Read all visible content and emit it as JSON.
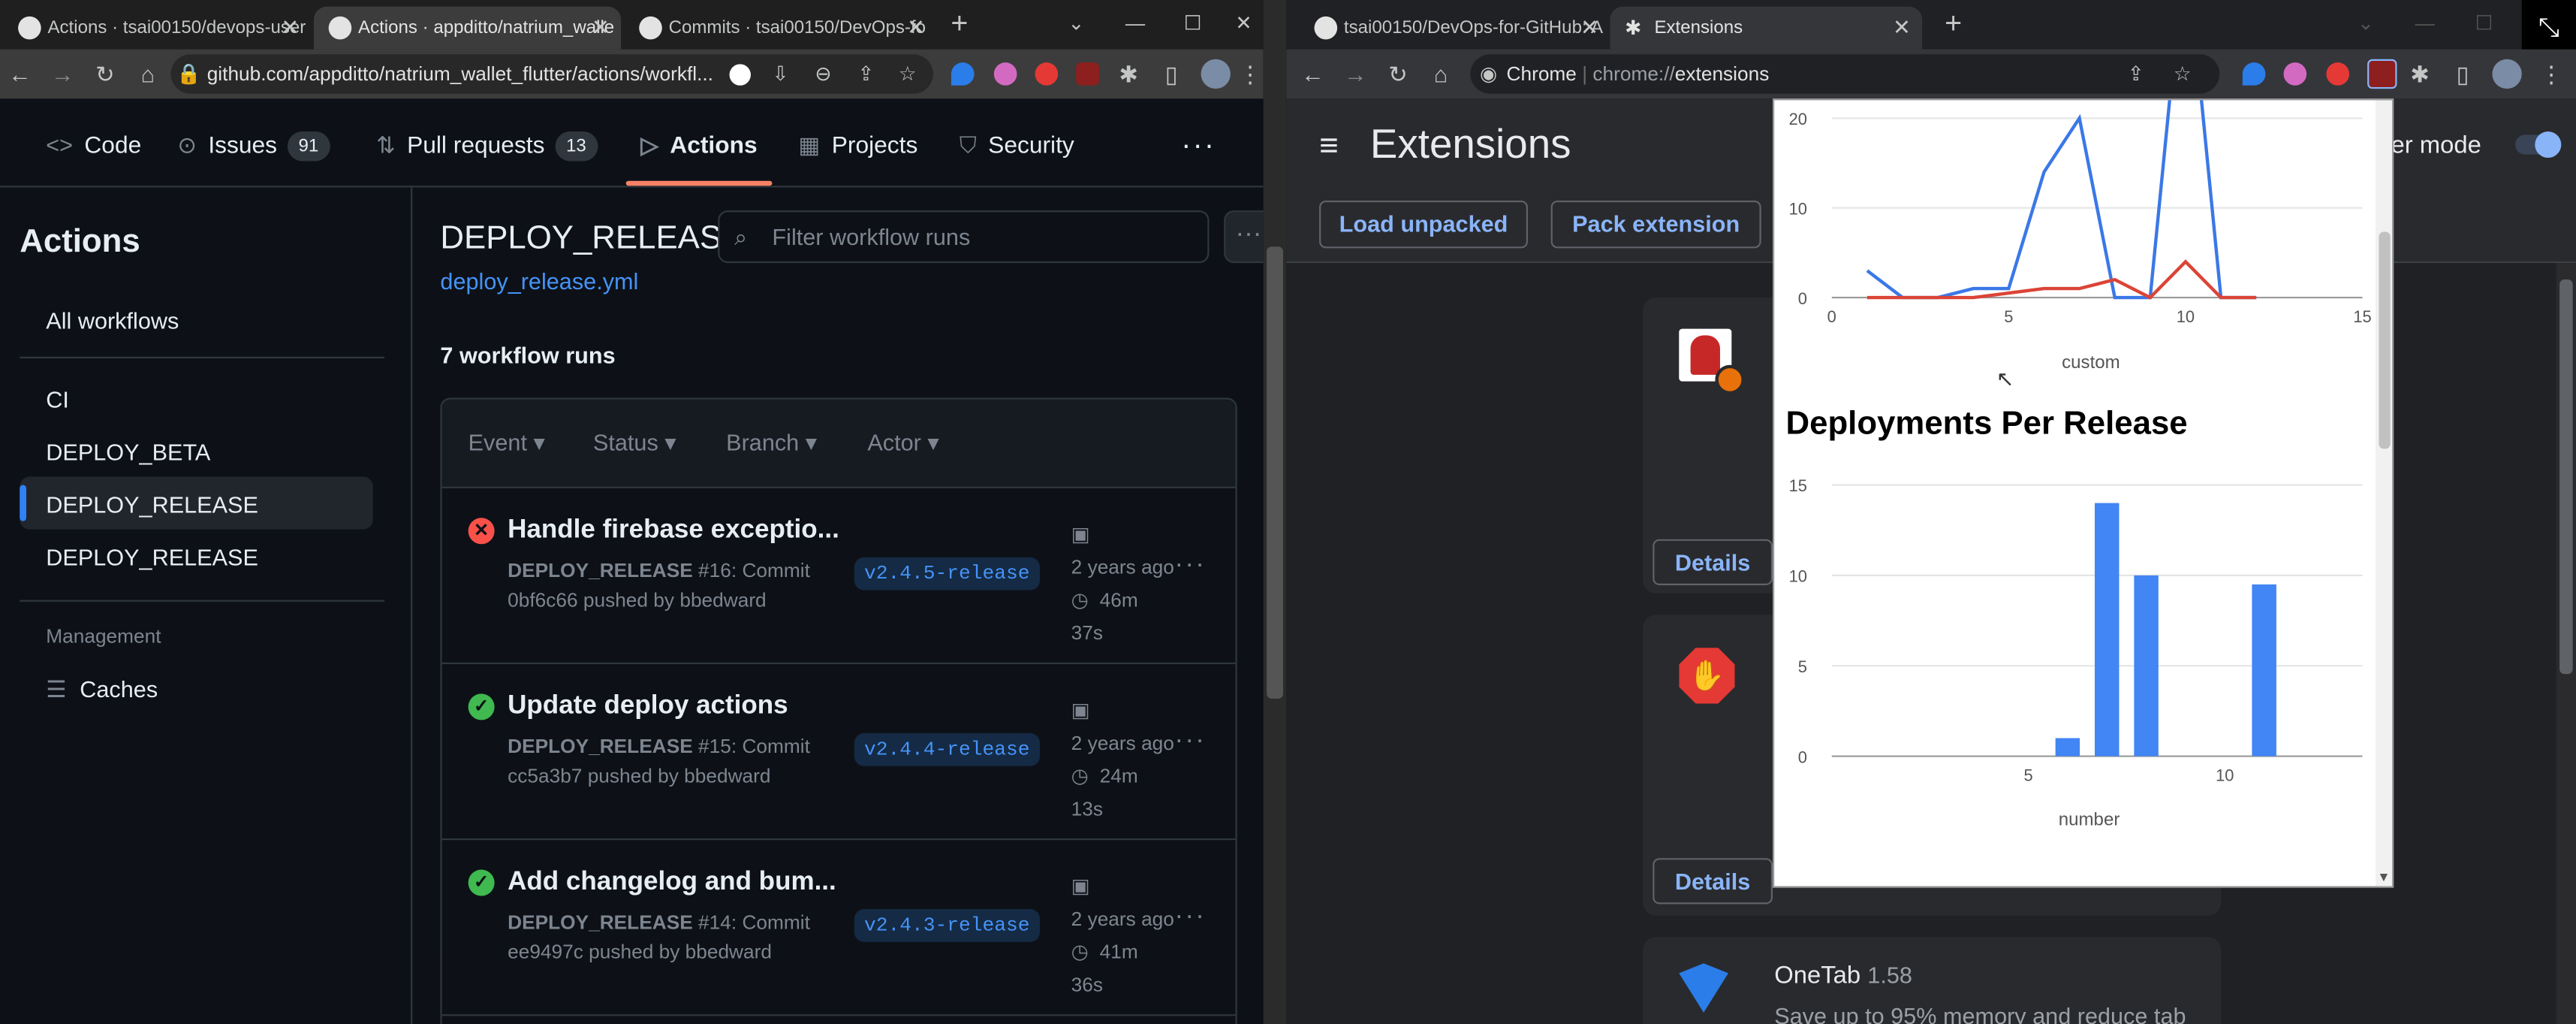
{
  "left_window": {
    "tabs": [
      {
        "label": "Actions · tsai00150/devops-user",
        "active": false
      },
      {
        "label": "Actions · appditto/natrium_walle",
        "active": true
      },
      {
        "label": "Commits · tsai00150/DevOps-fo",
        "active": false
      }
    ],
    "address": "github.com/appditto/natrium_wallet_flutter/actions/workfl...",
    "repo_nav": [
      {
        "icon": "code-icon",
        "label": "Code",
        "count": ""
      },
      {
        "icon": "issue-icon",
        "label": "Issues",
        "count": "91"
      },
      {
        "icon": "pull-request-icon",
        "label": "Pull requests",
        "count": "13"
      },
      {
        "icon": "play-icon",
        "label": "Actions",
        "count": ""
      },
      {
        "icon": "table-icon",
        "label": "Projects",
        "count": ""
      },
      {
        "icon": "shield-icon",
        "label": "Security",
        "count": ""
      }
    ],
    "sidebar": {
      "title": "Actions",
      "all_workflows": "All workflows",
      "workflows": [
        "CI",
        "DEPLOY_BETA",
        "DEPLOY_RELEASE",
        "DEPLOY_RELEASE"
      ],
      "selected_index": 2,
      "management_heading": "Management",
      "caches": "Caches"
    },
    "main": {
      "title": "DEPLOY_RELEASE",
      "file_link": "deploy_release.yml",
      "filter_placeholder": "Filter workflow runs",
      "run_count": "7 workflow runs",
      "filters": [
        "Event",
        "Status",
        "Branch",
        "Actor"
      ],
      "runs": [
        {
          "status": "failure",
          "title": "Handle firebase exceptio...",
          "workflow": "DEPLOY_RELEASE",
          "detail": "#16: Commit",
          "commit_line": "0bf6c66 pushed by bbedward",
          "branch": "v2.4.5-release",
          "date": "2 years ago",
          "duration_a": "46m",
          "duration_b": "37s"
        },
        {
          "status": "success",
          "title": "Update deploy actions",
          "workflow": "DEPLOY_RELEASE",
          "detail": "#15: Commit",
          "commit_line": "cc5a3b7 pushed by bbedward",
          "branch": "v2.4.4-release",
          "date": "2 years ago",
          "duration_a": "24m",
          "duration_b": "13s"
        },
        {
          "status": "success",
          "title": "Add changelog and bum...",
          "workflow": "DEPLOY_RELEASE",
          "detail": "#14: Commit",
          "commit_line": "ee9497c pushed by bbedward",
          "branch": "v2.4.3-release",
          "date": "2 years ago",
          "duration_a": "41m",
          "duration_b": "36s"
        }
      ]
    }
  },
  "right_window": {
    "tabs": [
      {
        "label": "tsai00150/DevOps-for-GitHub: A",
        "active": false
      },
      {
        "label": "Extensions",
        "active": true
      }
    ],
    "address_prefix": "Chrome",
    "address_scheme": "chrome://",
    "address_path": "extensions",
    "page_title": "Extensions",
    "dev_mode_partial": "per mode",
    "buttons": {
      "load_unpacked": "Load unpacked",
      "pack_extension": "Pack extension",
      "details": "Details"
    },
    "onetab": {
      "name": "OneTab",
      "version": "1.58",
      "description": "Save up to 95% memory and reduce tab"
    }
  },
  "popup": {
    "colors": {
      "series_blue": "#3b78e7",
      "series_red": "#db4437",
      "bar": "#4285f4"
    },
    "charts": [
      {
        "id": "custom",
        "title": "",
        "xlabel": "custom",
        "visible_clip": "top (y above ~22 cut off)"
      },
      {
        "id": "deployments",
        "title": "Deployments Per Release",
        "xlabel": "number"
      }
    ]
  },
  "chart_data": [
    {
      "type": "line",
      "title": "",
      "xlabel": "custom",
      "ylabel": "",
      "xlim": [
        0,
        15
      ],
      "ylim": [
        0,
        22
      ],
      "xticks": [
        0,
        5,
        10,
        15
      ],
      "yticks": [
        0,
        10,
        20
      ],
      "grid": true,
      "series": [
        {
          "x": [
            1,
            2,
            3,
            4,
            5,
            6,
            7,
            8,
            9,
            10,
            11,
            12
          ],
          "values": [
            3,
            0,
            0,
            1,
            1,
            14,
            20,
            0,
            0,
            40,
            0,
            0
          ],
          "color": "#3b78e7"
        },
        {
          "x": [
            1,
            2,
            3,
            4,
            5,
            6,
            7,
            8,
            9,
            10,
            11,
            12
          ],
          "values": [
            0,
            0,
            0,
            0,
            0.5,
            1,
            1,
            2,
            0,
            4,
            0,
            0
          ],
          "color": "#db4437"
        }
      ]
    },
    {
      "type": "bar",
      "title": "Deployments Per Release",
      "xlabel": "number",
      "ylabel": "",
      "xlim": [
        0,
        13.5
      ],
      "ylim": [
        0,
        15
      ],
      "xticks": [
        5,
        10
      ],
      "yticks": [
        0,
        5,
        10,
        15
      ],
      "grid": true,
      "x": [
        6,
        7,
        8,
        11
      ],
      "values": [
        1,
        14,
        10,
        9.5
      ]
    }
  ]
}
